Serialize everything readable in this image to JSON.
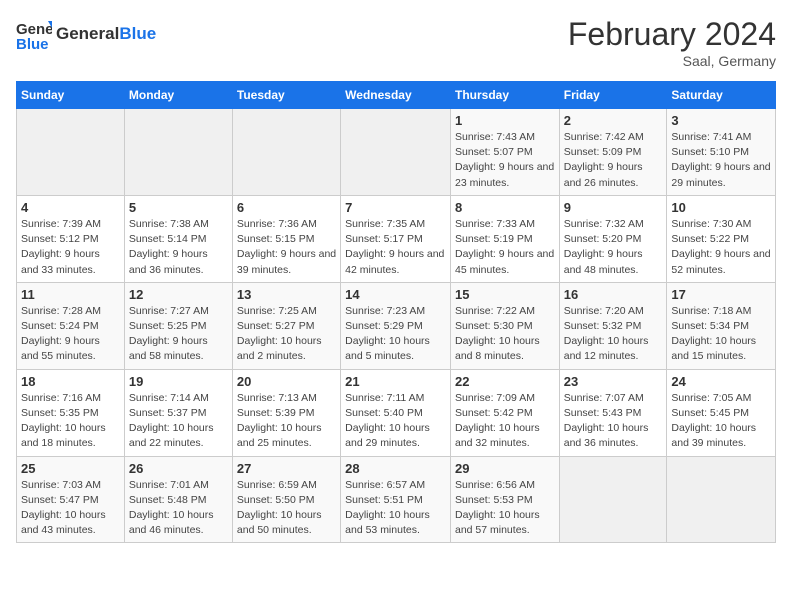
{
  "header": {
    "logo_general": "General",
    "logo_blue": "Blue",
    "month_title": "February 2024",
    "location": "Saal, Germany"
  },
  "weekdays": [
    "Sunday",
    "Monday",
    "Tuesday",
    "Wednesday",
    "Thursday",
    "Friday",
    "Saturday"
  ],
  "weeks": [
    [
      {
        "day": "",
        "info": ""
      },
      {
        "day": "",
        "info": ""
      },
      {
        "day": "",
        "info": ""
      },
      {
        "day": "",
        "info": ""
      },
      {
        "day": "1",
        "info": "Sunrise: 7:43 AM\nSunset: 5:07 PM\nDaylight: 9 hours and 23 minutes."
      },
      {
        "day": "2",
        "info": "Sunrise: 7:42 AM\nSunset: 5:09 PM\nDaylight: 9 hours and 26 minutes."
      },
      {
        "day": "3",
        "info": "Sunrise: 7:41 AM\nSunset: 5:10 PM\nDaylight: 9 hours and 29 minutes."
      }
    ],
    [
      {
        "day": "4",
        "info": "Sunrise: 7:39 AM\nSunset: 5:12 PM\nDaylight: 9 hours and 33 minutes."
      },
      {
        "day": "5",
        "info": "Sunrise: 7:38 AM\nSunset: 5:14 PM\nDaylight: 9 hours and 36 minutes."
      },
      {
        "day": "6",
        "info": "Sunrise: 7:36 AM\nSunset: 5:15 PM\nDaylight: 9 hours and 39 minutes."
      },
      {
        "day": "7",
        "info": "Sunrise: 7:35 AM\nSunset: 5:17 PM\nDaylight: 9 hours and 42 minutes."
      },
      {
        "day": "8",
        "info": "Sunrise: 7:33 AM\nSunset: 5:19 PM\nDaylight: 9 hours and 45 minutes."
      },
      {
        "day": "9",
        "info": "Sunrise: 7:32 AM\nSunset: 5:20 PM\nDaylight: 9 hours and 48 minutes."
      },
      {
        "day": "10",
        "info": "Sunrise: 7:30 AM\nSunset: 5:22 PM\nDaylight: 9 hours and 52 minutes."
      }
    ],
    [
      {
        "day": "11",
        "info": "Sunrise: 7:28 AM\nSunset: 5:24 PM\nDaylight: 9 hours and 55 minutes."
      },
      {
        "day": "12",
        "info": "Sunrise: 7:27 AM\nSunset: 5:25 PM\nDaylight: 9 hours and 58 minutes."
      },
      {
        "day": "13",
        "info": "Sunrise: 7:25 AM\nSunset: 5:27 PM\nDaylight: 10 hours and 2 minutes."
      },
      {
        "day": "14",
        "info": "Sunrise: 7:23 AM\nSunset: 5:29 PM\nDaylight: 10 hours and 5 minutes."
      },
      {
        "day": "15",
        "info": "Sunrise: 7:22 AM\nSunset: 5:30 PM\nDaylight: 10 hours and 8 minutes."
      },
      {
        "day": "16",
        "info": "Sunrise: 7:20 AM\nSunset: 5:32 PM\nDaylight: 10 hours and 12 minutes."
      },
      {
        "day": "17",
        "info": "Sunrise: 7:18 AM\nSunset: 5:34 PM\nDaylight: 10 hours and 15 minutes."
      }
    ],
    [
      {
        "day": "18",
        "info": "Sunrise: 7:16 AM\nSunset: 5:35 PM\nDaylight: 10 hours and 18 minutes."
      },
      {
        "day": "19",
        "info": "Sunrise: 7:14 AM\nSunset: 5:37 PM\nDaylight: 10 hours and 22 minutes."
      },
      {
        "day": "20",
        "info": "Sunrise: 7:13 AM\nSunset: 5:39 PM\nDaylight: 10 hours and 25 minutes."
      },
      {
        "day": "21",
        "info": "Sunrise: 7:11 AM\nSunset: 5:40 PM\nDaylight: 10 hours and 29 minutes."
      },
      {
        "day": "22",
        "info": "Sunrise: 7:09 AM\nSunset: 5:42 PM\nDaylight: 10 hours and 32 minutes."
      },
      {
        "day": "23",
        "info": "Sunrise: 7:07 AM\nSunset: 5:43 PM\nDaylight: 10 hours and 36 minutes."
      },
      {
        "day": "24",
        "info": "Sunrise: 7:05 AM\nSunset: 5:45 PM\nDaylight: 10 hours and 39 minutes."
      }
    ],
    [
      {
        "day": "25",
        "info": "Sunrise: 7:03 AM\nSunset: 5:47 PM\nDaylight: 10 hours and 43 minutes."
      },
      {
        "day": "26",
        "info": "Sunrise: 7:01 AM\nSunset: 5:48 PM\nDaylight: 10 hours and 46 minutes."
      },
      {
        "day": "27",
        "info": "Sunrise: 6:59 AM\nSunset: 5:50 PM\nDaylight: 10 hours and 50 minutes."
      },
      {
        "day": "28",
        "info": "Sunrise: 6:57 AM\nSunset: 5:51 PM\nDaylight: 10 hours and 53 minutes."
      },
      {
        "day": "29",
        "info": "Sunrise: 6:56 AM\nSunset: 5:53 PM\nDaylight: 10 hours and 57 minutes."
      },
      {
        "day": "",
        "info": ""
      },
      {
        "day": "",
        "info": ""
      }
    ]
  ]
}
